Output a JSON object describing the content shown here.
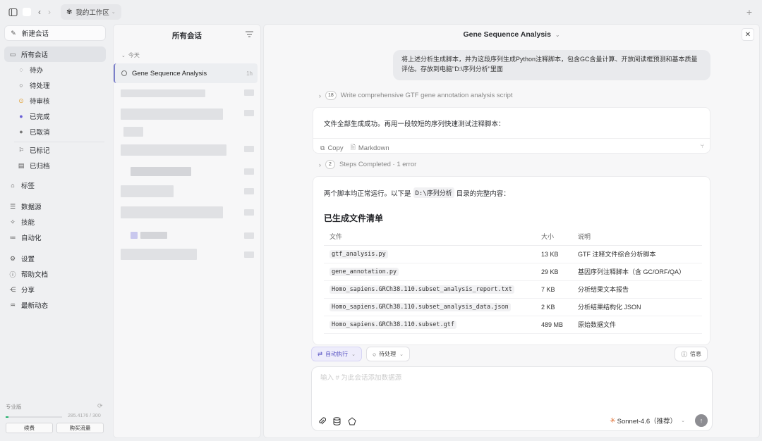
{
  "topbar": {
    "workspace_label": "我的工作区",
    "back_glyph": "‹",
    "forward_glyph": "›",
    "new_tab_glyph": "+"
  },
  "sidebar": {
    "new_chat": "新建会话",
    "all_chats": "所有会话",
    "status_items": [
      {
        "label": "待办",
        "icon": "dashed-circle-icon"
      },
      {
        "label": "待处理",
        "icon": "circle-icon"
      },
      {
        "label": "待审核",
        "icon": "dot-circle-icon",
        "color": "#e0a23a"
      },
      {
        "label": "已完成",
        "icon": "check-circle-icon",
        "color": "#6a60d6"
      },
      {
        "label": "已取消",
        "icon": "x-circle-icon",
        "color": "#777777"
      }
    ],
    "flagged": "已标记",
    "archived": "已归档",
    "tags": "标签",
    "nav": [
      {
        "label": "数据源",
        "icon": "database-icon"
      },
      {
        "label": "技能",
        "icon": "skill-icon"
      },
      {
        "label": "自动化",
        "icon": "automation-icon"
      }
    ],
    "nav2": [
      {
        "label": "设置",
        "icon": "settings-icon"
      },
      {
        "label": "帮助文档",
        "icon": "help-icon"
      },
      {
        "label": "分享",
        "icon": "share-icon"
      },
      {
        "label": "最新动态",
        "icon": "news-icon"
      }
    ],
    "plan_label": "专业版",
    "quota_text": "285.4176 / 300",
    "quota_used_fraction": 0.05,
    "renew": "续费",
    "buy_traffic": "购买流量"
  },
  "conversations": {
    "title": "所有会话",
    "group_today": "今天",
    "active": {
      "title": "Gene Sequence Analysis",
      "time": "1h"
    }
  },
  "chat": {
    "title": "Gene Sequence Analysis",
    "user_message": "将上述分析生成脚本，并为这段序列生成Python注释脚本，包含GC含量计算、开放阅读框预测和基本质量评估。存放到电脑\"D:\\序列分析\"里面",
    "step1_count": "18",
    "step1_label": "Write comprehensive GTF gene annotation analysis script",
    "reply1": "文件全部生成成功。再用一段较短的序列快速测试注释脚本：",
    "copy_label": "Copy",
    "markdown_label": "Markdown",
    "step2_count": "2",
    "step2_label": "Steps Completed · 1 error",
    "reply2_pre": "两个脚本均正常运行。以下是",
    "reply2_path": "D:\\序列分析",
    "reply2_post": "目录的完整内容：",
    "heading": "已生成文件清单",
    "table": {
      "headers": [
        "文件",
        "大小",
        "说明"
      ],
      "rows": [
        {
          "file": "gtf_analysis.py",
          "size": "13 KB",
          "desc": "GTF 注释文件综合分析脚本"
        },
        {
          "file": "gene_annotation.py",
          "size": "29 KB",
          "desc": "基因序列注释脚本（含 GC/ORF/QA）"
        },
        {
          "file": "Homo_sapiens.GRCh38.110.subset_analysis_report.txt",
          "size": "7 KB",
          "desc": "分析结果文本报告"
        },
        {
          "file": "Homo_sapiens.GRCh38.110.subset_analysis_data.json",
          "size": "2 KB",
          "desc": "分析结果结构化 JSON"
        },
        {
          "file": "Homo_sapiens.GRCh38.110.subset.gtf",
          "size": "489 MB",
          "desc": "原始数据文件"
        }
      ]
    }
  },
  "composer": {
    "auto_exec": "自动执行",
    "status": "待处理",
    "info": "信息",
    "placeholder": "输入 # 为此会话添加数据源",
    "model": "Sonnet-4.6（推荐）"
  }
}
